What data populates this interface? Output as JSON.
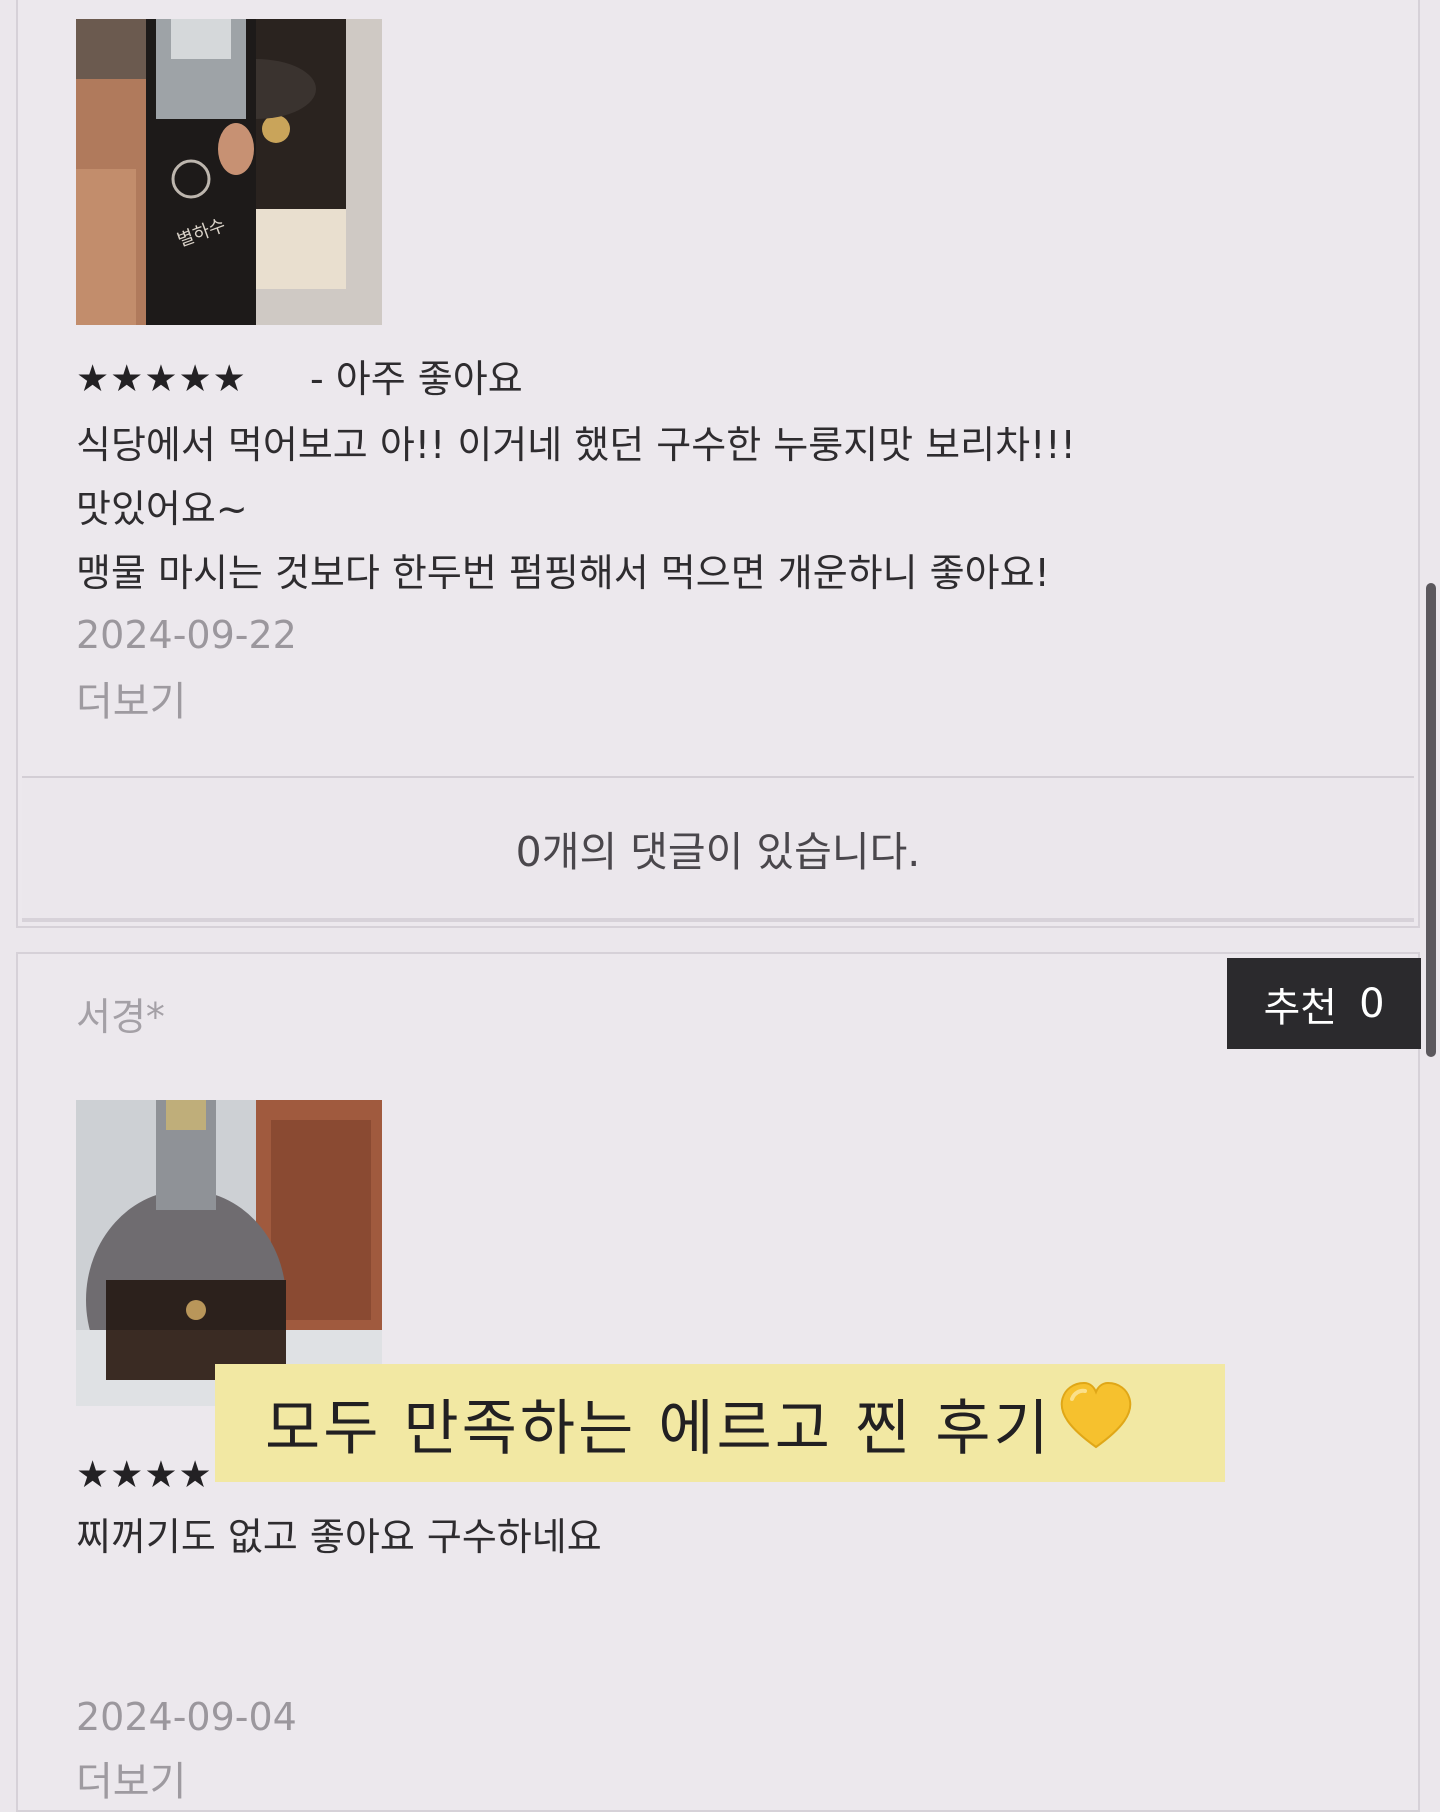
{
  "review_1": {
    "stars": "★★★★★",
    "rating_label": "- 아주 좋아요",
    "body_lines": [
      "식당에서 먹어보고 아!! 이거네 했던 구수한 누룽지맛 보리차!!!",
      "맛있어요~",
      "맹물 마시는 것보다 한두번 펌핑해서 먹으면 개운하니 좋아요!"
    ],
    "date": "2024-09-22",
    "more_label": "더보기",
    "comments_label": "0개의 댓글이 있습니다.",
    "photo_icon": "product-bottle-photo"
  },
  "review_2": {
    "author": "서경*",
    "recommend_label": "추천",
    "recommend_count": "0",
    "stars": "★★★★",
    "body_lines": [
      "찌꺼기도 없고 좋아요 구수하네요"
    ],
    "date": "2024-09-04",
    "more_label": "더보기",
    "photo_icon": "product-bottle-photo"
  },
  "overlay": {
    "caption": "모두 만족하는 에르고 찐 후기",
    "heart_icon": "yellow-heart-icon",
    "color": "#f2e8a3"
  }
}
